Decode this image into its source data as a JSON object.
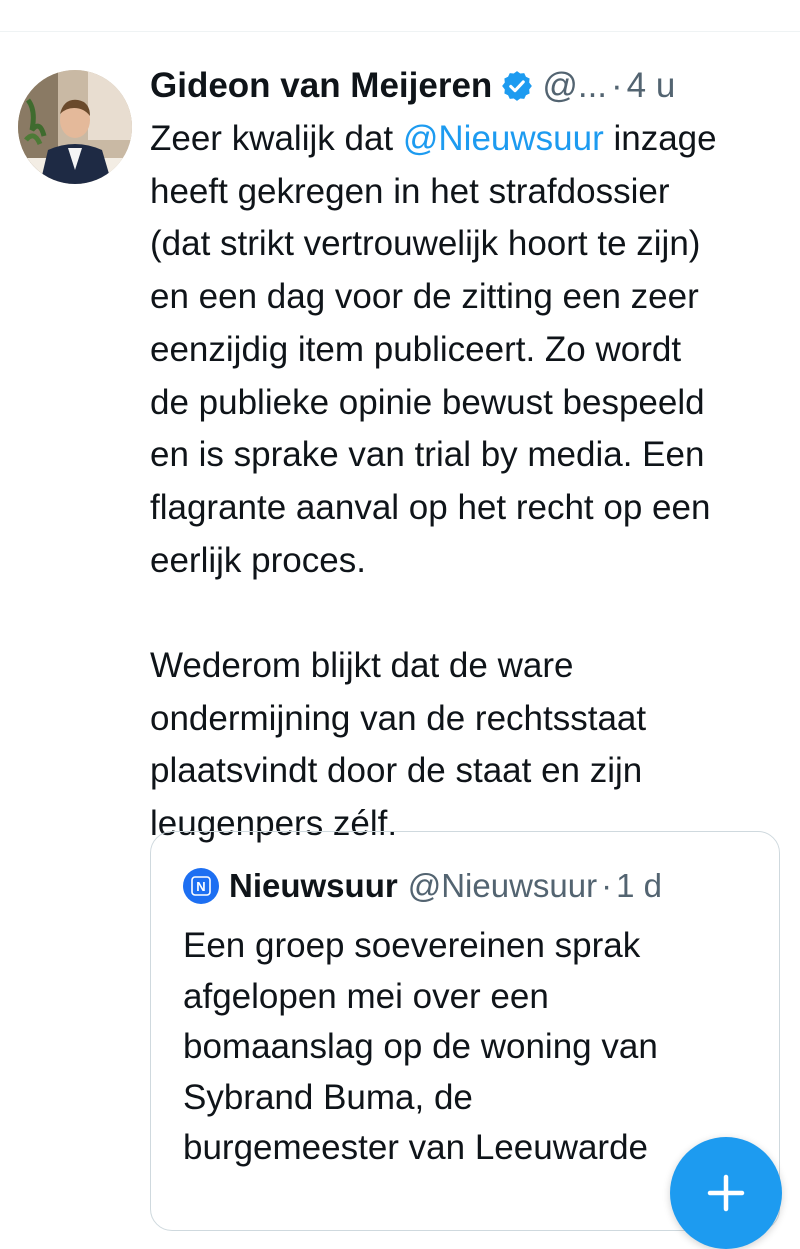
{
  "tweet": {
    "author_name": "Gideon van Meijeren",
    "handle": "@...",
    "separator": "·",
    "time": "4 u",
    "text_before_mention": "Zeer kwalijk dat ",
    "mention": "@Nieuwsuur",
    "text_after_mention": " inzage\nheeft gekregen in het strafdossier\n(dat strikt vertrouwelijk hoort te zijn)\nen een dag voor de zitting een zeer\neenzijdig item publiceert. Zo wordt\nde publieke opinie bewust bespeeld\nen is sprake van trial by media. Een\nflagrante aanval op het recht op een\neerlijk proces.\n\nWederom blijkt dat de ware\nondermijning van de rechtsstaat\nplaatsvindt door de staat en zijn\nleugenpers zélf."
  },
  "quoted_tweet": {
    "avatar_letter": "N",
    "author_name": "Nieuwsuur",
    "handle": "@Nieuwsuur",
    "separator": "·",
    "time": "1 d",
    "text": "Een groep soevereinen sprak\nafgelopen mei over een\nbomaanslag op de woning van\nSybrand Buma, de\nburgemeester van Leeuwarde"
  },
  "icons": {
    "verified": "verified-badge-icon",
    "compose": "plus-icon"
  },
  "colors": {
    "accent": "#1d9bf0",
    "text": "#0f1419",
    "muted": "#536471",
    "border": "#cfd9de"
  }
}
